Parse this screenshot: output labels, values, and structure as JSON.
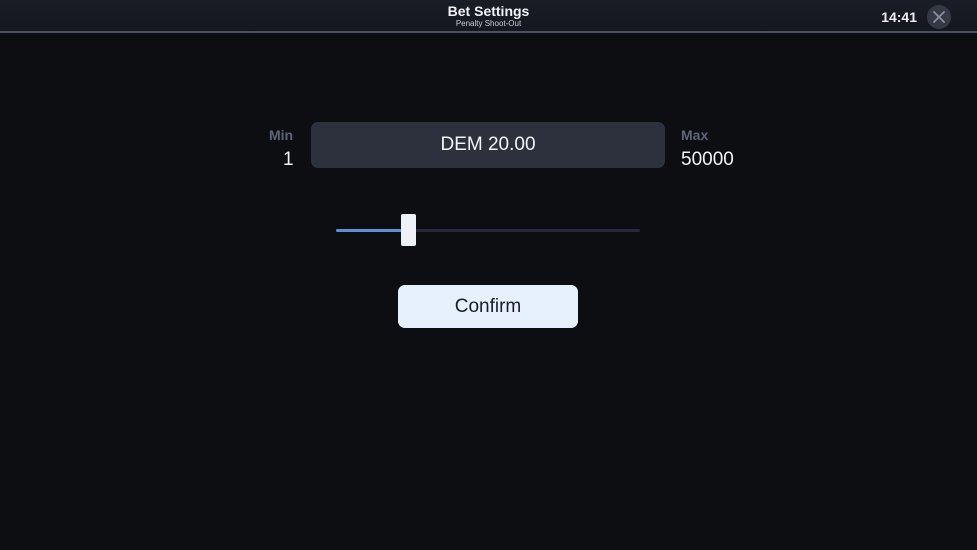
{
  "header": {
    "title": "Bet Settings",
    "subtitle": "Penalty Shoot-Out",
    "time": "14:41",
    "close_icon": "close-icon"
  },
  "bet": {
    "min_label": "Min",
    "min_value": "1",
    "max_label": "Max",
    "max_value": "50000",
    "current_value": "DEM 20.00",
    "slider_fraction": 0.24
  },
  "actions": {
    "confirm_label": "Confirm"
  },
  "colors": {
    "background": "#0d0e12",
    "accent": "#5b8fd6",
    "button_bg": "#e7f1fe"
  }
}
